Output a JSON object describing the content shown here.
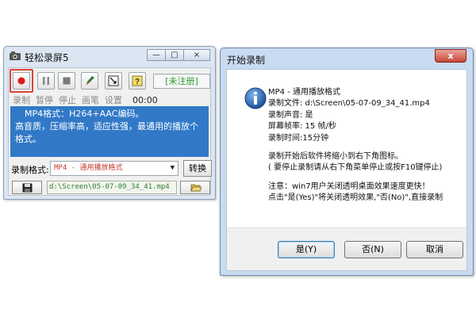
{
  "recorder": {
    "title": "轻松录屏5",
    "minimize": "—",
    "maximize": "□",
    "close": "×",
    "register_label": "[未注册]",
    "toolbar_labels": [
      "录制",
      "暂停",
      "停止",
      "画笔",
      "设置"
    ],
    "timer": "00:00",
    "info_lines": [
      "MP4格式：H264+AAC编码。",
      "高音质，压缩率高，适应性强，最通用的播放个",
      "格式。"
    ],
    "format_label": "录制格式:",
    "format_value": "MP4 - 通用播放格式",
    "switch_label": "转换",
    "output_path": "d:\\Screen\\05-07-09_34_41.mp4",
    "colors": {
      "record_red": "#d9453a",
      "panel_blue": "#3179c7",
      "register_green": "#2f9b2f"
    }
  },
  "dialog": {
    "title": "开始录制",
    "close": "x",
    "lines": [
      "MP4 - 通用播放格式",
      "录制文件: d:\\Screen\\05-07-09_34_41.mp4",
      "录制声音: 是",
      "屏幕帧率: 15 帧/秒",
      "录制时间:15分钟"
    ],
    "note_lines": [
      "录制开始后软件将缩小到右下角图标。",
      "( 要停止录制请从右下角菜单停止或按F10键停止)"
    ],
    "warn_lines": [
      "注意：win7用户关闭透明桌面效果速度更快！",
      " 点击\"是(Yes)\"将关闭透明效果,\"否(No)\",直接录制"
    ],
    "buttons": {
      "yes": "是(Y)",
      "no": "否(N)",
      "cancel": "取消"
    }
  }
}
